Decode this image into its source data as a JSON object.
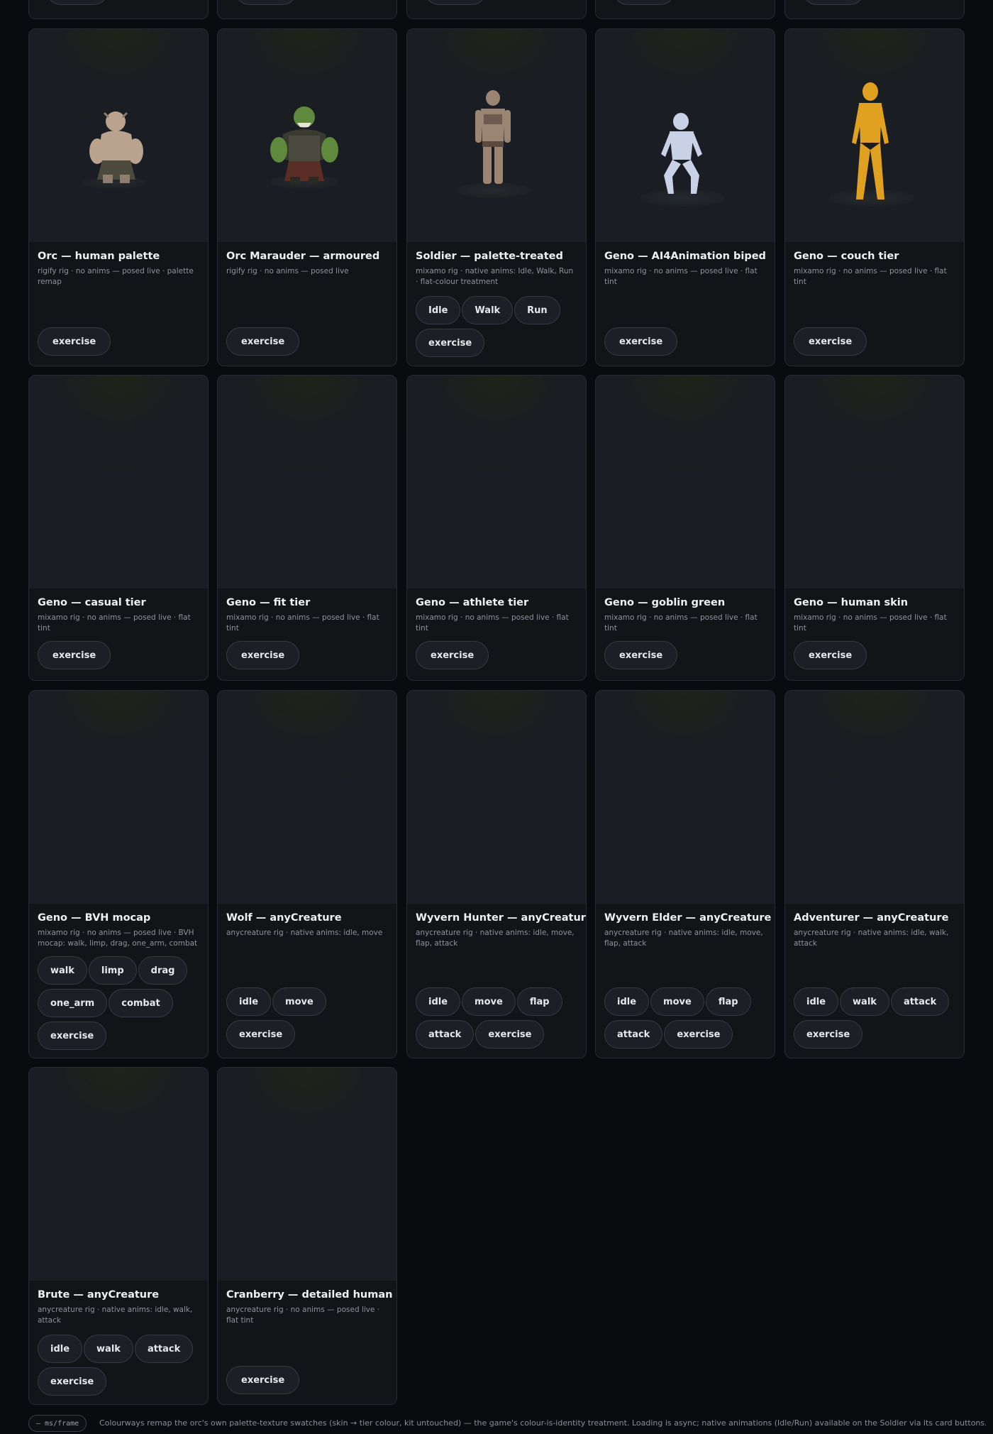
{
  "cards": [
    {
      "title": "Orc — human palette",
      "subtitle": "rigify rig · no anims — posed live · palette remap",
      "anims": [],
      "action": "exercise"
    },
    {
      "title": "Orc Marauder — armoured",
      "subtitle": "rigify rig · no anims — posed live",
      "anims": [],
      "action": "exercise"
    },
    {
      "title": "Soldier — palette-treated",
      "subtitle": "mixamo rig · native anims: Idle, Walk, Run · flat-colour treatment",
      "anims": [
        "Idle",
        "Walk",
        "Run"
      ],
      "action": "exercise"
    },
    {
      "title": "Geno — AI4Animation biped",
      "subtitle": "mixamo rig · no anims — posed live · flat tint",
      "anims": [],
      "action": "exercise"
    },
    {
      "title": "Geno — couch tier",
      "subtitle": "mixamo rig · no anims — posed live · flat tint",
      "anims": [],
      "action": "exercise"
    },
    {
      "title": "Geno — casual tier",
      "subtitle": "mixamo rig · no anims — posed live · flat tint",
      "anims": [],
      "action": "exercise"
    },
    {
      "title": "Geno — fit tier",
      "subtitle": "mixamo rig · no anims — posed live · flat tint",
      "anims": [],
      "action": "exercise"
    },
    {
      "title": "Geno — athlete tier",
      "subtitle": "mixamo rig · no anims — posed live · flat tint",
      "anims": [],
      "action": "exercise"
    },
    {
      "title": "Geno — goblin green",
      "subtitle": "mixamo rig · no anims — posed live · flat tint",
      "anims": [],
      "action": "exercise"
    },
    {
      "title": "Geno — human skin",
      "subtitle": "mixamo rig · no anims — posed live · flat tint",
      "anims": [],
      "action": "exercise"
    },
    {
      "title": "Geno — BVH mocap",
      "subtitle": "mixamo rig · no anims — posed live · BVH mocap: walk, limp, drag, one_arm, combat",
      "anims": [
        "walk",
        "limp",
        "drag",
        "one_arm",
        "combat"
      ],
      "action": "exercise"
    },
    {
      "title": "Wolf — anyCreature",
      "subtitle": "anycreature rig · native anims: idle, move",
      "anims": [
        "idle",
        "move"
      ],
      "action": "exercise"
    },
    {
      "title": "Wyvern Hunter — anyCreature",
      "subtitle": "anycreature rig · native anims: idle, move, flap, attack",
      "anims": [
        "idle",
        "move",
        "flap",
        "attack"
      ],
      "action": "exercise"
    },
    {
      "title": "Wyvern Elder — anyCreature",
      "subtitle": "anycreature rig · native anims: idle, move, flap, attack",
      "anims": [
        "idle",
        "move",
        "flap",
        "attack"
      ],
      "action": "exercise"
    },
    {
      "title": "Adventurer — anyCreature",
      "subtitle": "anycreature rig · native anims: idle, walk, attack",
      "anims": [
        "idle",
        "walk",
        "attack"
      ],
      "action": "exercise"
    },
    {
      "title": "Brute — anyCreature",
      "subtitle": "anycreature rig · native anims: idle, walk, attack",
      "anims": [
        "idle",
        "walk",
        "attack"
      ],
      "action": "exercise"
    },
    {
      "title": "Cranberry — detailed human",
      "subtitle": "anycreature rig · no anims — posed live · flat tint",
      "anims": [],
      "action": "exercise"
    }
  ],
  "footer": {
    "ms_badge": "— ms/frame",
    "note": "Colourways remap the orc's own palette-texture swatches (skin → tier colour, kit untouched) — the game's colour-is-identity treatment. Loading is async; native animations (Idle/Run) available on the Soldier via its card buttons."
  },
  "colors": {
    "background": "#0a0b0e",
    "card": "#121418",
    "card_border": "#262a32",
    "chip": "#1c1f26",
    "figure_orc_skin": "#b9a28e",
    "figure_marauder": "#5f8a3e",
    "figure_soldier": "#9c8472",
    "figure_biped": "#c9d1e6",
    "figure_couch": "#e0a020"
  }
}
